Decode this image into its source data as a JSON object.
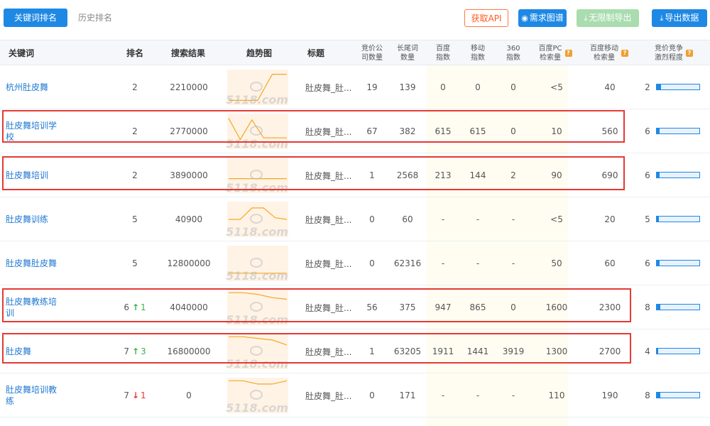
{
  "topbar": {
    "tab_active": "关键词排名",
    "tab_inactive": "历史排名",
    "btn_api": "获取API",
    "btn_graph": "需求图谱",
    "btn_unlimited": "无限制导出",
    "btn_export": "导出数据"
  },
  "headers": {
    "keyword": "关键词",
    "rank": "排名",
    "results": "搜索结果",
    "trend": "趋势图",
    "title": "标题",
    "bid_count_1": "竞价公",
    "bid_count_2": "司数量",
    "longtail_1": "长尾词",
    "longtail_2": "数量",
    "baidu_1": "百度",
    "baidu_2": "指数",
    "mobile_1": "移动",
    "mobile_2": "指数",
    "s360_1": "360",
    "s360_2": "指数",
    "pc_1": "百度PC",
    "pc_2": "检索量",
    "mob_1": "百度移动",
    "mob_2": "检索量",
    "comp_1": "竞价竞争",
    "comp_2": "激烈程度"
  },
  "watermark": "5118.com",
  "rows": [
    {
      "keyword": "杭州肚皮舞",
      "rank": "2",
      "change_dir": "",
      "change": "",
      "results": "2210000",
      "title": "肚皮舞_肚...",
      "bid": "19",
      "longtail": "139",
      "baidu": "0",
      "mobile": "0",
      "s360": "0",
      "pc": "<5",
      "mob": "40",
      "comp": "2",
      "comp_level": 0.1,
      "trend": [
        10,
        10,
        10,
        90,
        90
      ]
    },
    {
      "keyword": "肚皮舞培训学校",
      "rank": "2",
      "change_dir": "",
      "change": "",
      "results": "2770000",
      "title": "肚皮舞_肚...",
      "bid": "67",
      "longtail": "382",
      "baidu": "615",
      "mobile": "615",
      "s360": "0",
      "pc": "10",
      "mob": "560",
      "comp": "6",
      "comp_level": 0.06,
      "trend": [
        90,
        25,
        85,
        30,
        30,
        30
      ]
    },
    {
      "keyword": "肚皮舞培训",
      "rank": "2",
      "change_dir": "",
      "change": "",
      "results": "3890000",
      "title": "肚皮舞_肚...",
      "bid": "1",
      "longtail": "2568",
      "baidu": "213",
      "mobile": "144",
      "s360": "2",
      "pc": "90",
      "mob": "690",
      "comp": "6",
      "comp_level": 0.06,
      "trend": [
        40,
        40,
        40,
        40,
        40
      ]
    },
    {
      "keyword": "肚皮舞训练",
      "rank": "5",
      "change_dir": "",
      "change": "",
      "results": "40900",
      "title": "肚皮舞_肚...",
      "bid": "0",
      "longtail": "60",
      "baidu": "-",
      "mobile": "-",
      "s360": "-",
      "pc": "<5",
      "mob": "20",
      "comp": "5",
      "comp_level": 0.05,
      "trend": [
        50,
        50,
        85,
        85,
        55,
        50
      ]
    },
    {
      "keyword": "肚皮舞肚皮舞",
      "rank": "5",
      "change_dir": "",
      "change": "",
      "results": "12800000",
      "title": "肚皮舞_肚...",
      "bid": "0",
      "longtail": "62316",
      "baidu": "-",
      "mobile": "-",
      "s360": "-",
      "pc": "50",
      "mob": "60",
      "comp": "6",
      "comp_level": 0.06,
      "trend": [
        20,
        20,
        20,
        20,
        20
      ]
    },
    {
      "keyword": "肚皮舞教练培训",
      "rank": "6",
      "change_dir": "up",
      "change": "1",
      "results": "4040000",
      "title": "肚皮舞_肚...",
      "bid": "56",
      "longtail": "375",
      "baidu": "947",
      "mobile": "865",
      "s360": "0",
      "pc": "1600",
      "mob": "2300",
      "comp": "8",
      "comp_level": 0.08,
      "trend": [
        95,
        95,
        90,
        80,
        75
      ]
    },
    {
      "keyword": "肚皮舞",
      "rank": "7",
      "change_dir": "up",
      "change": "3",
      "results": "16800000",
      "title": "肚皮舞_肚...",
      "bid": "1",
      "longtail": "63205",
      "baidu": "1911",
      "mobile": "1441",
      "s360": "3919",
      "pc": "1300",
      "mob": "2700",
      "comp": "4",
      "comp_level": 0.04,
      "trend": [
        95,
        95,
        90,
        85,
        70
      ]
    },
    {
      "keyword": "肚皮舞培训教练",
      "rank": "7",
      "change_dir": "down",
      "change": "1",
      "results": "0",
      "title": "肚皮舞_肚...",
      "bid": "0",
      "longtail": "171",
      "baidu": "-",
      "mobile": "-",
      "s360": "-",
      "pc": "110",
      "mob": "190",
      "comp": "8",
      "comp_level": 0.08,
      "trend": [
        95,
        95,
        85,
        85,
        95
      ]
    }
  ]
}
